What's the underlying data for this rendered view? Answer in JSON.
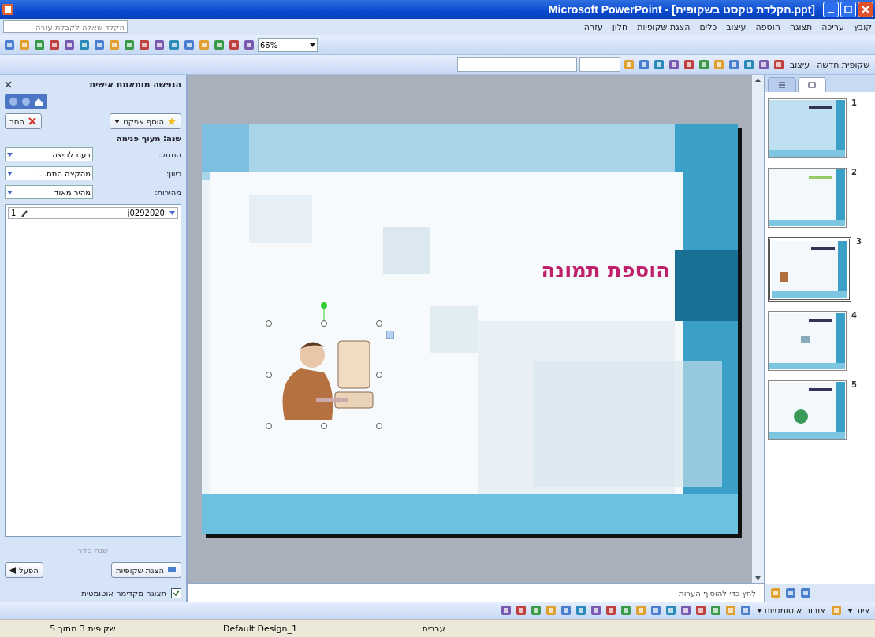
{
  "window": {
    "title": "Microsoft PowerPoint - [הקלדת טקסט בשקופית.ppt]"
  },
  "menu": [
    "קובץ",
    "עריכה",
    "תצוגה",
    "הוספה",
    "עיצוב",
    "כלים",
    "הצגת שקופיות",
    "חלון",
    "עזרה"
  ],
  "help_box": {
    "placeholder": "הקלד שאלה לקבלת עזרה"
  },
  "standard_toolbar": {
    "zoom": "66%"
  },
  "formatting_toolbar": {
    "design_button": "עיצוב",
    "new_slide_button": "שקופית חדשה"
  },
  "task_pane": {
    "title": "הנפשה מותאמת אישית",
    "add_effect": "הוסף אפקט",
    "remove": "הסר",
    "change_label": "שנה: מעוף פנימה",
    "fields": [
      {
        "label": "התחל:",
        "value": "בעת לחיצה"
      },
      {
        "label": "כיוון:",
        "value": "מהקצה התח..."
      },
      {
        "label": "מהירות:",
        "value": "מהיר מאוד"
      }
    ],
    "animations": [
      {
        "number": "1",
        "name": "j0292020"
      }
    ],
    "reorder": {
      "label": "שנה סדר",
      "disabled": true
    },
    "play": "הפעל",
    "slide_show": "הצגת שקופיות",
    "autopreview": {
      "label": "תצוגה מקדימה אוטומטית",
      "checked": true
    }
  },
  "slide": {
    "title": "הוספת תמונה"
  },
  "notes": {
    "placeholder": "לחץ כדי להוסיף הערות"
  },
  "thumbnails": [
    {
      "number": "1",
      "selected": false
    },
    {
      "number": "2",
      "selected": false
    },
    {
      "number": "3",
      "selected": true
    },
    {
      "number": "4",
      "selected": false
    },
    {
      "number": "5",
      "selected": false
    }
  ],
  "drawing_toolbar": {
    "draw": "ציור",
    "autoshapes": "צורות אוטומטיות"
  },
  "status_bar": [
    "עברית",
    "Default Design_1",
    "שקופית 3 מתוך 5"
  ]
}
